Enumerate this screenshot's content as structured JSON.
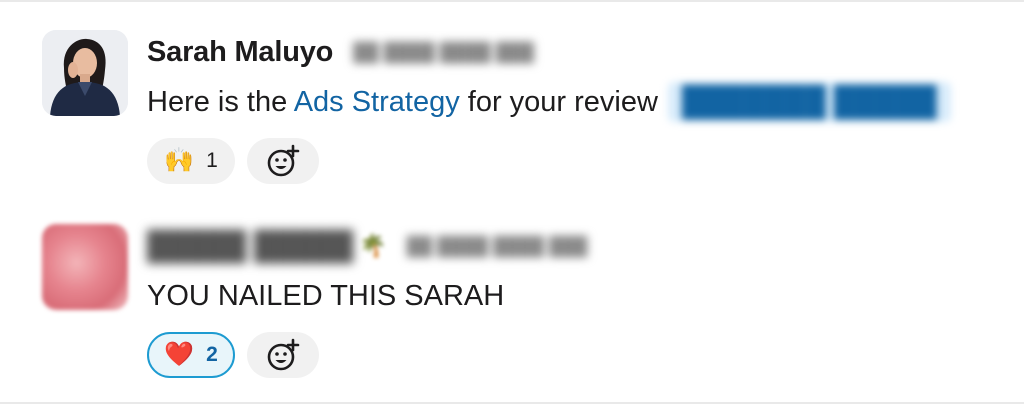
{
  "messages": [
    {
      "sender": "Sarah Maluyo",
      "text_before_link": "Here is the ",
      "link_text": "Ads Strategy",
      "text_after_link": " for your review",
      "reactions": [
        {
          "emoji": "🙌",
          "icon": "raised-hands",
          "count": "1",
          "active": false
        }
      ]
    },
    {
      "text": "YOU NAILED THIS SARAH",
      "reactions": [
        {
          "emoji": "❤️",
          "icon": "red-heart",
          "count": "2",
          "active": true
        }
      ]
    }
  ],
  "icons": {
    "add_reaction": "smiley-plus-icon"
  },
  "colors": {
    "link": "#1264a3",
    "reaction_active_border": "#1d9bd1",
    "reaction_active_bg": "#e8f5fa",
    "reaction_bg": "#f1f1f1"
  }
}
